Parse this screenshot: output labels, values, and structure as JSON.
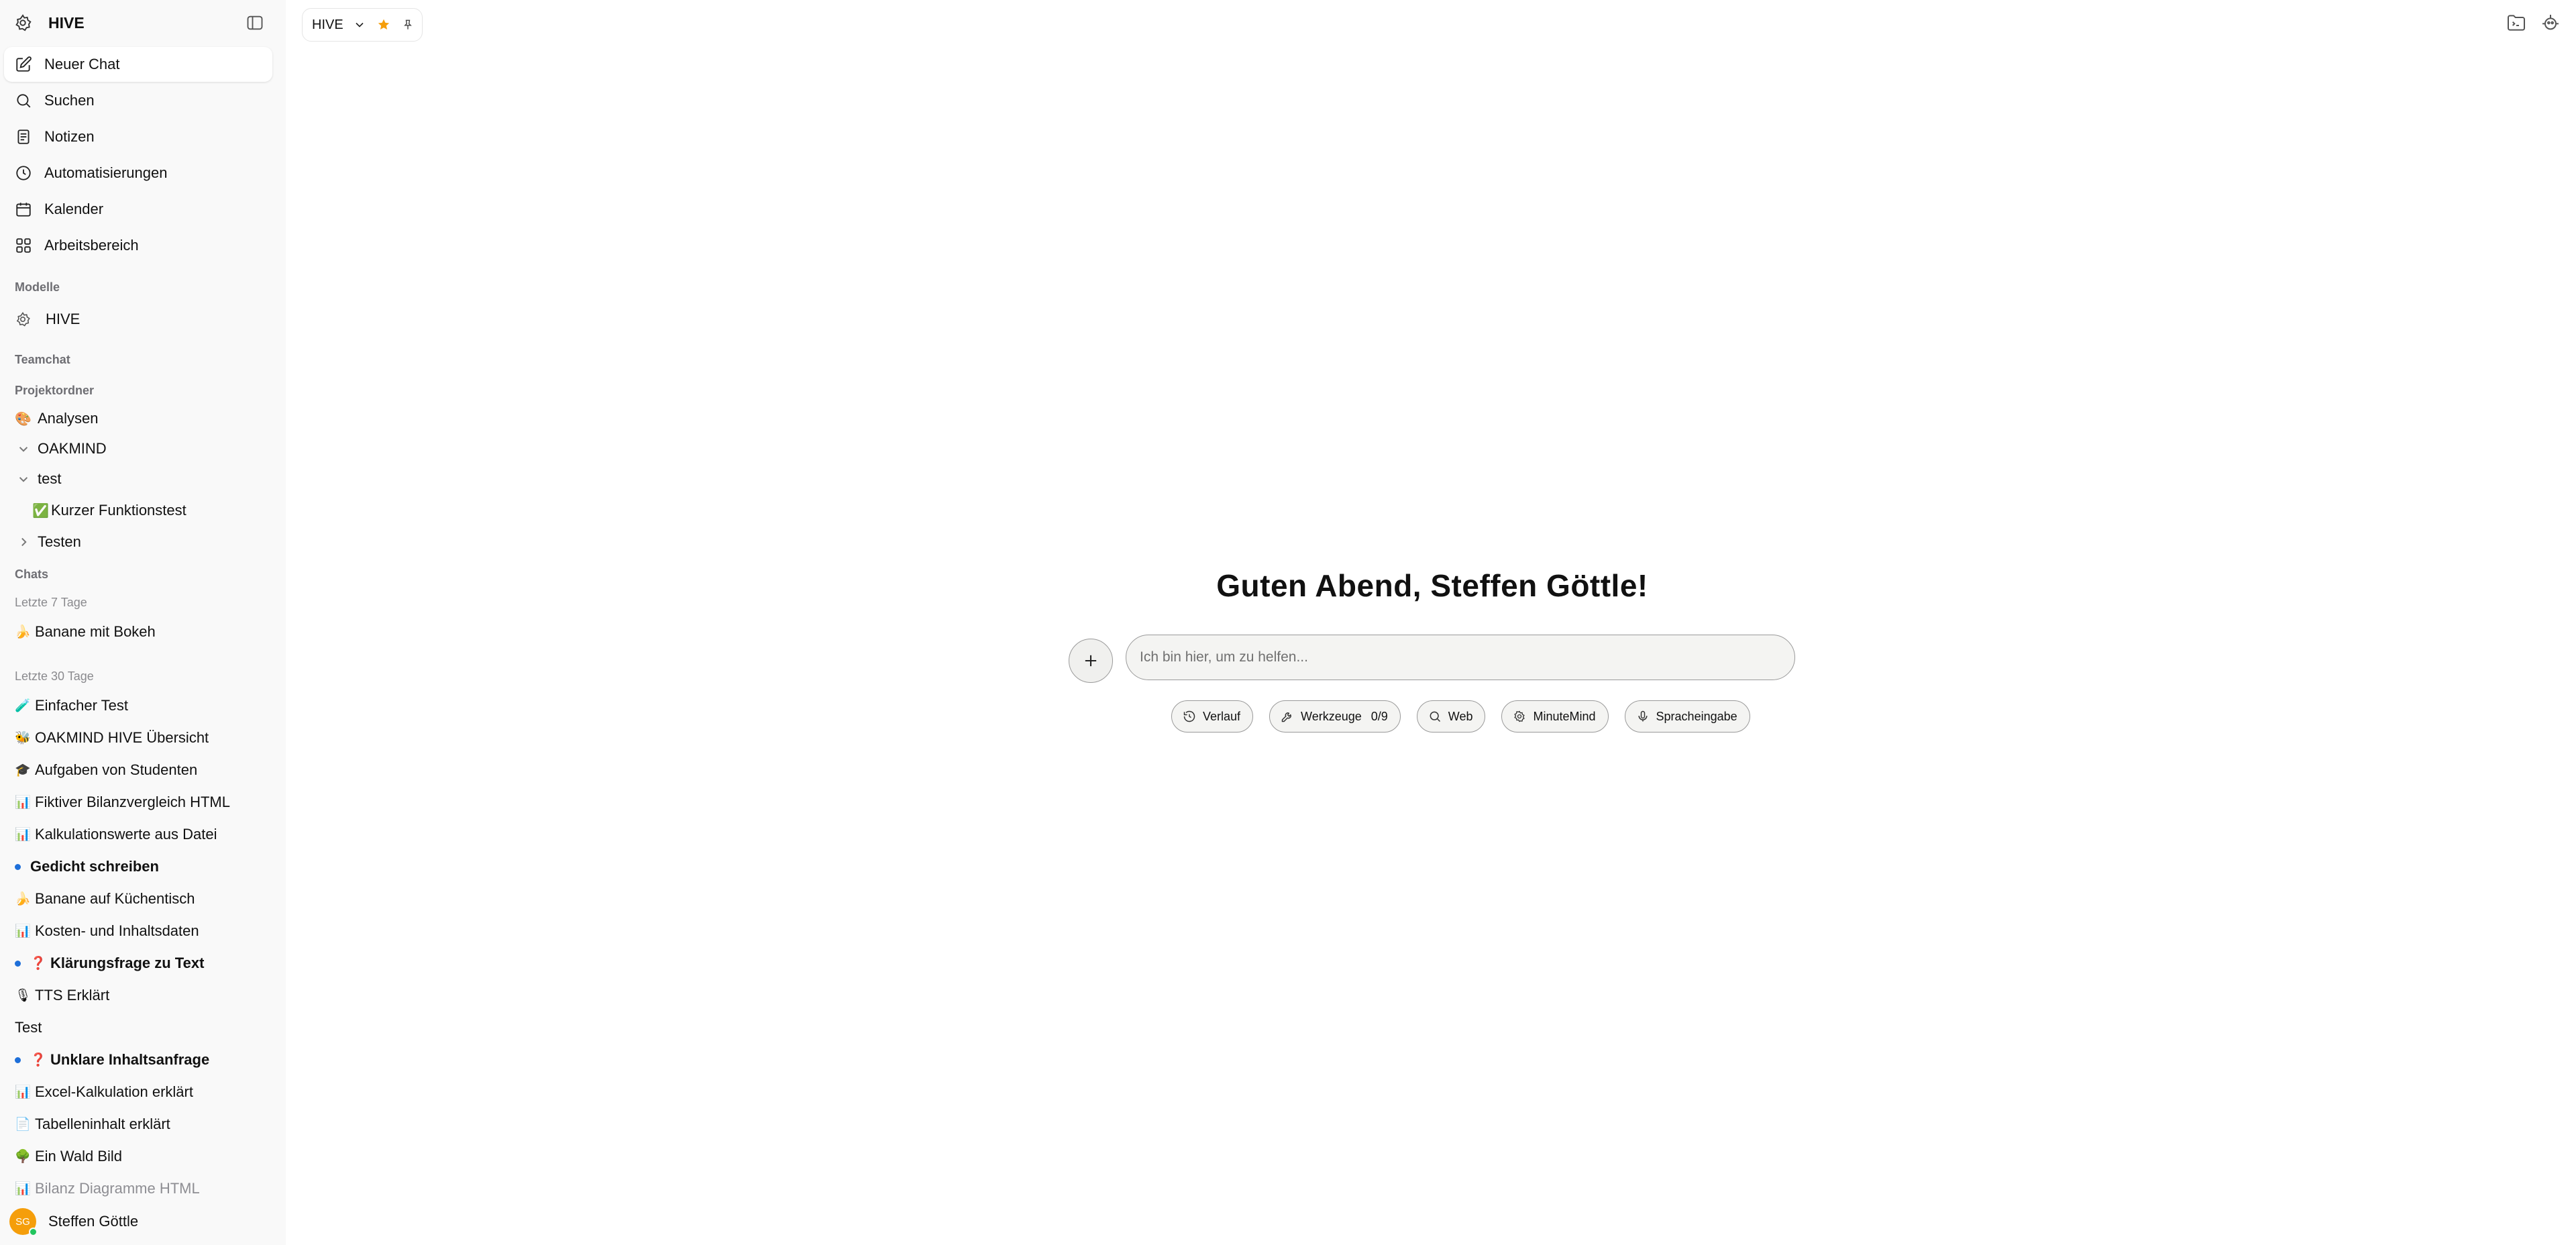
{
  "app": {
    "name": "HIVE"
  },
  "nav": [
    {
      "label": "Neuer Chat",
      "icon": "new-chat-icon"
    },
    {
      "label": "Suchen",
      "icon": "search-icon"
    },
    {
      "label": "Notizen",
      "icon": "notes-icon"
    },
    {
      "label": "Automatisierungen",
      "icon": "clock-icon"
    },
    {
      "label": "Kalender",
      "icon": "calendar-icon"
    },
    {
      "label": "Arbeitsbereich",
      "icon": "workspace-icon"
    }
  ],
  "sections": {
    "models": "Modelle",
    "teamchat": "Teamchat",
    "projects": "Projektordner",
    "chats": "Chats",
    "last7": "Letzte 7 Tage",
    "last30": "Letzte 30 Tage"
  },
  "models": [
    {
      "label": "HIVE"
    }
  ],
  "projects": [
    {
      "emoji": "🎨",
      "label": "Analysen"
    },
    {
      "label": "OAKMIND"
    },
    {
      "label": "test"
    },
    {
      "emoji": "✅",
      "label": "Kurzer Funktionstest"
    },
    {
      "label": "Testen"
    }
  ],
  "chats_last7": [
    {
      "emoji": "🍌",
      "label": "Banane mit Bokeh"
    }
  ],
  "chats_last30": [
    {
      "emoji": "🧪",
      "label": "Einfacher Test"
    },
    {
      "emoji": "🐝",
      "label": "OAKMIND HIVE Übersicht"
    },
    {
      "emoji": "🎓",
      "label": "Aufgaben von Studenten"
    },
    {
      "emoji": "📊",
      "label": "Fiktiver Bilanzvergleich HTML"
    },
    {
      "emoji": "📊",
      "label": "Kalkulationswerte aus Datei"
    },
    {
      "label": "Gedicht schreiben"
    },
    {
      "emoji": "🍌",
      "label": "Banane auf Küchentisch"
    },
    {
      "emoji": "📊",
      "label": "Kosten- und Inhaltsdaten"
    },
    {
      "emoji": "❓",
      "label": "Klärungsfrage zu Text"
    },
    {
      "emoji": "🎙",
      "label": "TTS Erklärt"
    },
    {
      "label": "Test"
    },
    {
      "emoji": "❓",
      "label": "Unklare Inhaltsanfrage"
    },
    {
      "emoji": "📊",
      "label": "Excel-Kalkulation erklärt"
    },
    {
      "emoji": "📄",
      "label": "Tabelleninhalt erklärt"
    },
    {
      "emoji": "🌳",
      "label": "Ein Wald Bild"
    },
    {
      "emoji": "📊",
      "label": "Bilanz Diagramme HTML"
    }
  ],
  "user": {
    "initials": "SG",
    "name": "Steffen Göttle"
  },
  "header": {
    "model": "HIVE"
  },
  "main": {
    "greeting": "Guten Abend, Steffen Göttle!",
    "placeholder": "Ich bin hier, um zu helfen...",
    "chips": {
      "history": "Verlauf",
      "tools": "Werkzeuge",
      "tools_count": "0/9",
      "web": "Web",
      "minutemind": "MinuteMind",
      "voice": "Spracheingabe"
    }
  },
  "colors": {
    "sidebar_bg": "#f9f9f9",
    "accent_star": "#f59e0b",
    "unread_dot": "#1e6fd9",
    "avatar_bg": "#f59e0b"
  }
}
